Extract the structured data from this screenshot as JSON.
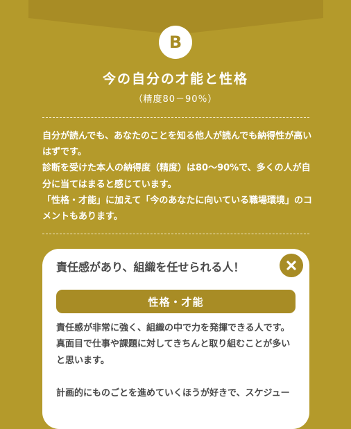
{
  "header": {
    "badge_letter": "B",
    "title": "今の自分の才能と性格",
    "subtitle": "（精度80－90％）"
  },
  "description": {
    "lines": [
      "自分が読んでも、あなたのことを知る他人が読んでも納得性が高いはずです。",
      "診断を受けた本人の納得度（精度）は80〜90%で、多くの人が自分に当てはまると感じています。",
      "「性格・才能」に加えて「今のあなたに向いている職場環境」のコメントもあります。"
    ]
  },
  "card": {
    "title": "責任感があり、組織を任せられる人！",
    "close_icon": "close-icon",
    "section_label": "性格・才能",
    "body_lines": [
      "責任感が非常に強く、組織の中で力を発揮できる人です。",
      "真面目で仕事や課題に対してきちんと取り組むことが多いと思います。",
      "",
      "計画的にものごとを進めていくほうが好きで、スケジュー"
    ]
  },
  "colors": {
    "background": "#b49a2b",
    "accent": "#a88c25",
    "card": "#ffffff",
    "text_dark": "#4a4a4a"
  }
}
